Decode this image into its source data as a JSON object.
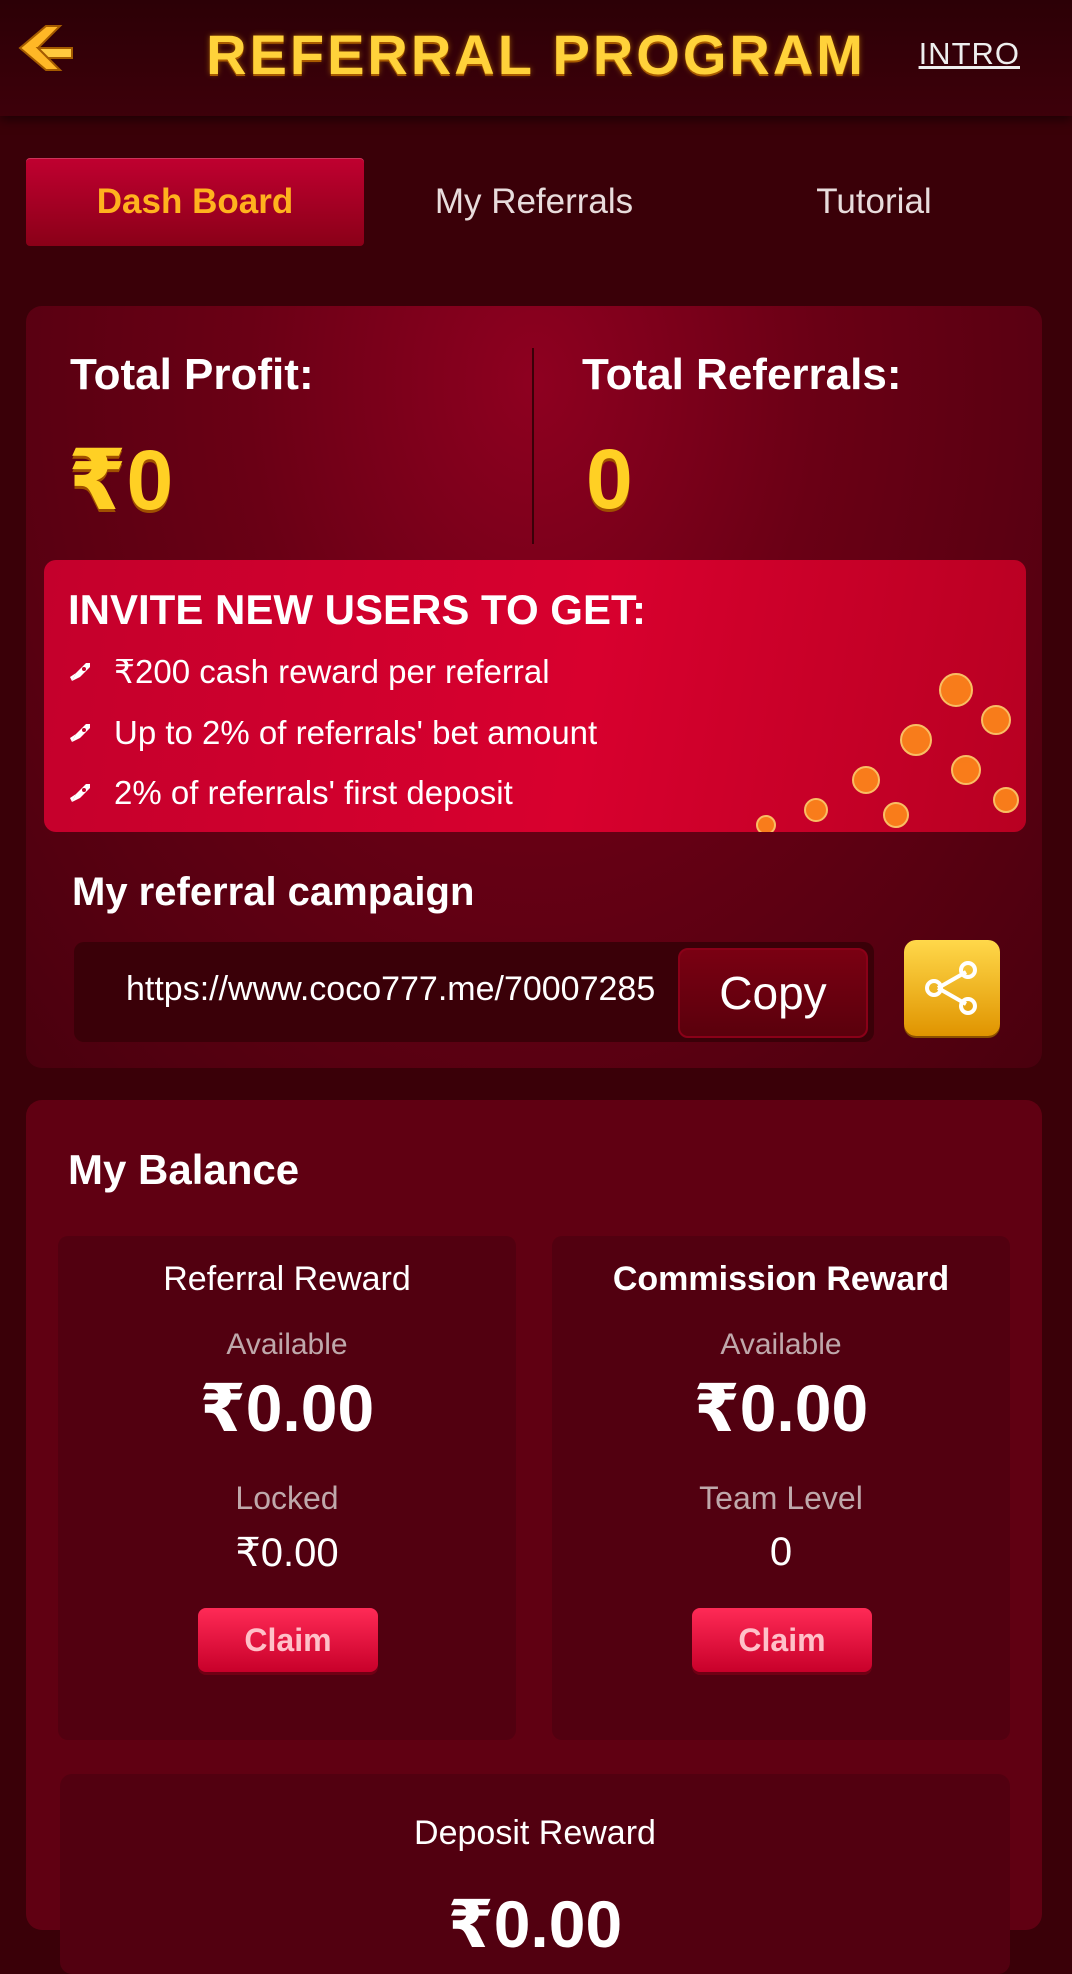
{
  "header": {
    "title": "REFERRAL PROGRAM",
    "intro_label": "INTRO",
    "back_icon": "back-arrow-icon"
  },
  "tabs": [
    {
      "label": "Dash Board",
      "active": true
    },
    {
      "label": "My Referrals",
      "active": false
    },
    {
      "label": "Tutorial",
      "active": false
    }
  ],
  "stats": {
    "total_profit_label": "Total Profit:",
    "total_profit_value": "₹0",
    "total_referrals_label": "Total Referrals:",
    "total_referrals_value": "0"
  },
  "invite": {
    "title": "INVITE NEW USERS TO GET:",
    "items": [
      "₹200 cash reward per referral",
      "Up to 2% of referrals' bet amount",
      "2% of referrals' first deposit"
    ],
    "bullet_icon": "rocket-icon"
  },
  "campaign": {
    "label": "My referral campaign",
    "link": "https://www.coco777.me/70007285",
    "copy_label": "Copy",
    "share_icon": "share-icon"
  },
  "balance": {
    "title": "My Balance",
    "referral": {
      "name": "Referral Reward",
      "available_label": "Available",
      "available_value": "₹0.00",
      "locked_label": "Locked",
      "locked_value": "₹0.00",
      "claim_label": "Claim"
    },
    "commission": {
      "name": "Commission Reward",
      "available_label": "Available",
      "available_value": "₹0.00",
      "team_level_label": "Team Level",
      "team_level_value": "0",
      "claim_label": "Claim"
    },
    "deposit": {
      "name": "Deposit Reward",
      "value": "₹0.00"
    }
  },
  "colors": {
    "background": "#3a0008",
    "accent_gold": "#ffd23a",
    "active_tab": "#c00030",
    "claim_button": "#ff2a56"
  }
}
